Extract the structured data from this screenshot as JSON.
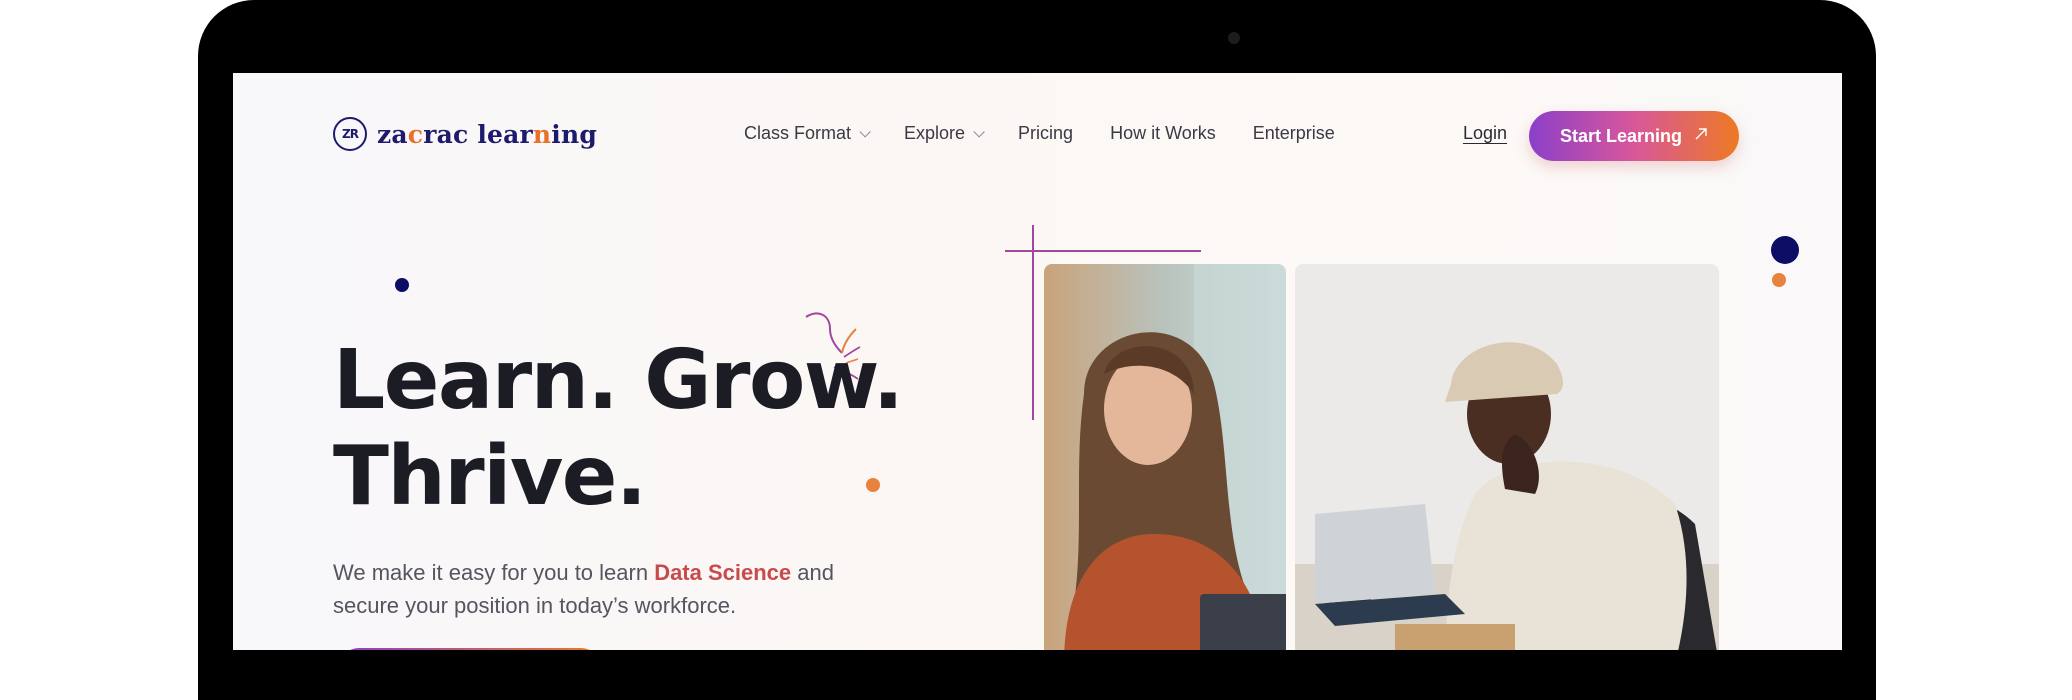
{
  "brand": {
    "logo_mark": "ZR",
    "name_parts": [
      "za",
      "c",
      "rac lear",
      "n",
      "ing"
    ]
  },
  "nav": {
    "items": [
      {
        "label": "Class Format",
        "has_dropdown": true
      },
      {
        "label": "Explore",
        "has_dropdown": true
      },
      {
        "label": "Pricing",
        "has_dropdown": false
      },
      {
        "label": "How it Works",
        "has_dropdown": false
      },
      {
        "label": "Enterprise",
        "has_dropdown": false
      }
    ],
    "login_label": "Login",
    "cta_label": "Start Learning",
    "cta_icon": "arrow-up-right-icon"
  },
  "hero": {
    "title_line1": "Learn. Grow.",
    "title_line2": "Thrive.",
    "subtitle_before": "We make it easy for you to learn ",
    "subtitle_highlight": "Data Science",
    "subtitle_after": " and secure your position in today’s workforce."
  },
  "images": {
    "left_photo": "woman-studying-photo",
    "right_photo": "man-at-laptop-photo"
  },
  "colors": {
    "brand_navy": "#1d1b6b",
    "brand_orange": "#e8702a",
    "highlight": "#c94a4a",
    "gradient_start": "#8c3fc9",
    "gradient_end": "#ec7a23"
  }
}
